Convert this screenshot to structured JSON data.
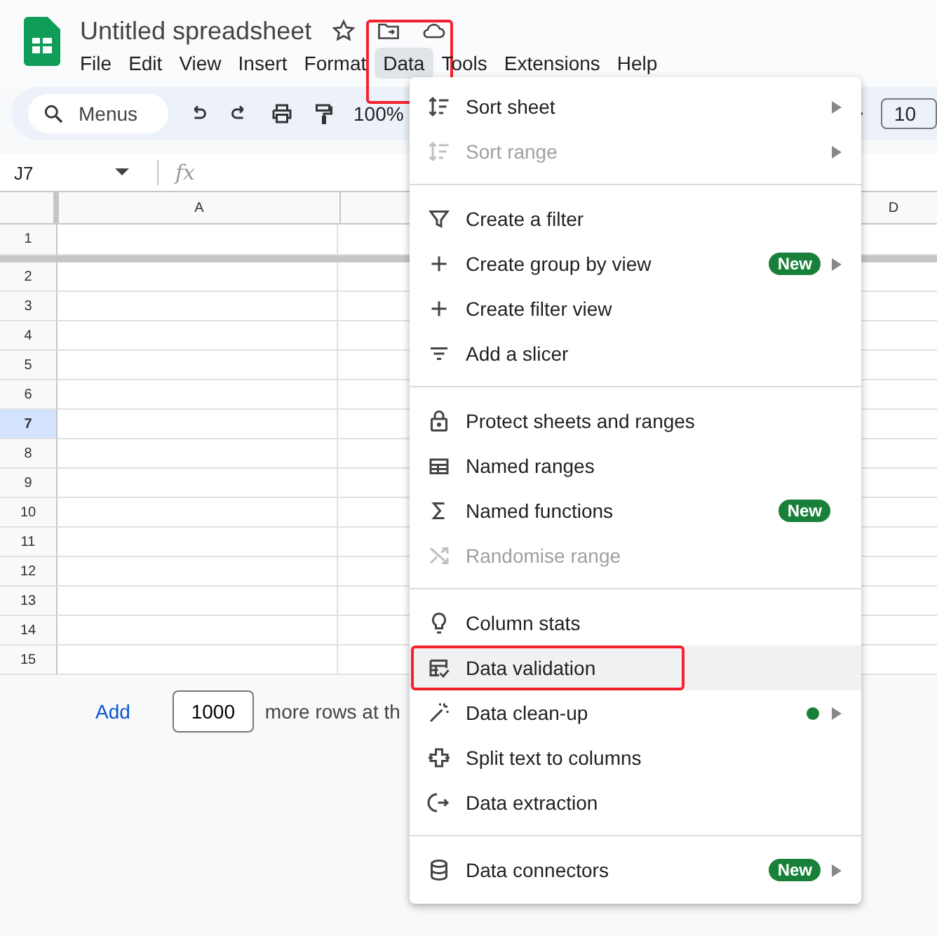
{
  "app": {
    "title": "Untitled spreadsheet"
  },
  "menubar": [
    {
      "label": "File",
      "selected": false,
      "annotated": false
    },
    {
      "label": "Edit",
      "selected": false,
      "annotated": false
    },
    {
      "label": "View",
      "selected": false,
      "annotated": false
    },
    {
      "label": "Insert",
      "selected": false,
      "annotated": false
    },
    {
      "label": "Format",
      "selected": false,
      "annotated": false
    },
    {
      "label": "Data",
      "selected": true,
      "annotated": true
    },
    {
      "label": "Tools",
      "selected": false,
      "annotated": false
    },
    {
      "label": "Extensions",
      "selected": false,
      "annotated": false
    },
    {
      "label": "Help",
      "selected": false,
      "annotated": false
    }
  ],
  "toolbar": {
    "search_placeholder": "Menus",
    "zoom": "100%",
    "font_size": "10"
  },
  "formula_bar": {
    "cell_ref": "J7",
    "fx": "fx"
  },
  "grid": {
    "columns": [
      "A",
      "D"
    ],
    "rows": [
      {
        "label": "1",
        "selected": false
      },
      {
        "label": "2",
        "selected": false
      },
      {
        "label": "3",
        "selected": false
      },
      {
        "label": "4",
        "selected": false
      },
      {
        "label": "5",
        "selected": false
      },
      {
        "label": "6",
        "selected": false
      },
      {
        "label": "7",
        "selected": true
      },
      {
        "label": "8",
        "selected": false
      },
      {
        "label": "9",
        "selected": false
      },
      {
        "label": "10",
        "selected": false
      },
      {
        "label": "11",
        "selected": false
      },
      {
        "label": "12",
        "selected": false
      },
      {
        "label": "13",
        "selected": false
      },
      {
        "label": "14",
        "selected": false
      },
      {
        "label": "15",
        "selected": false
      }
    ]
  },
  "add_rows": {
    "link": "Add",
    "value": "1000",
    "text": "more rows at th"
  },
  "data_menu": {
    "groups": [
      [
        {
          "label": "Sort sheet",
          "disabled": false,
          "submenu": true,
          "highlighted": false,
          "annotated": false
        },
        {
          "label": "Sort range",
          "disabled": true,
          "submenu": true,
          "highlighted": false,
          "annotated": false
        }
      ],
      [
        {
          "label": "Create a filter",
          "disabled": false,
          "submenu": false,
          "highlighted": false,
          "annotated": false
        },
        {
          "label": "Create group by view",
          "disabled": false,
          "submenu": true,
          "badge": "New",
          "highlighted": false,
          "annotated": false
        },
        {
          "label": "Create filter view",
          "disabled": false,
          "submenu": false,
          "highlighted": false,
          "annotated": false
        },
        {
          "label": "Add a slicer",
          "disabled": false,
          "submenu": false,
          "highlighted": false,
          "annotated": false
        }
      ],
      [
        {
          "label": "Protect sheets and ranges",
          "disabled": false,
          "submenu": false,
          "highlighted": false,
          "annotated": false
        },
        {
          "label": "Named ranges",
          "disabled": false,
          "submenu": false,
          "highlighted": false,
          "annotated": false
        },
        {
          "label": "Named functions",
          "disabled": false,
          "submenu": false,
          "badge": "New",
          "highlighted": false,
          "annotated": false
        },
        {
          "label": "Randomise range",
          "disabled": true,
          "submenu": false,
          "highlighted": false,
          "annotated": false
        }
      ],
      [
        {
          "label": "Column stats",
          "disabled": false,
          "submenu": false,
          "highlighted": false,
          "annotated": false
        },
        {
          "label": "Data validation",
          "disabled": false,
          "submenu": false,
          "highlighted": true,
          "annotated": true
        },
        {
          "label": "Data clean-up",
          "disabled": false,
          "submenu": true,
          "color": "#188038",
          "highlighted": false,
          "annotated": false
        },
        {
          "label": "Split text to columns",
          "disabled": false,
          "submenu": false,
          "highlighted": false,
          "annotated": false
        },
        {
          "label": "Data extraction",
          "disabled": false,
          "submenu": false,
          "highlighted": false,
          "annotated": false
        }
      ],
      [
        {
          "label": "Data connectors",
          "disabled": false,
          "submenu": true,
          "badge": "New",
          "highlighted": false,
          "annotated": false
        }
      ]
    ]
  }
}
